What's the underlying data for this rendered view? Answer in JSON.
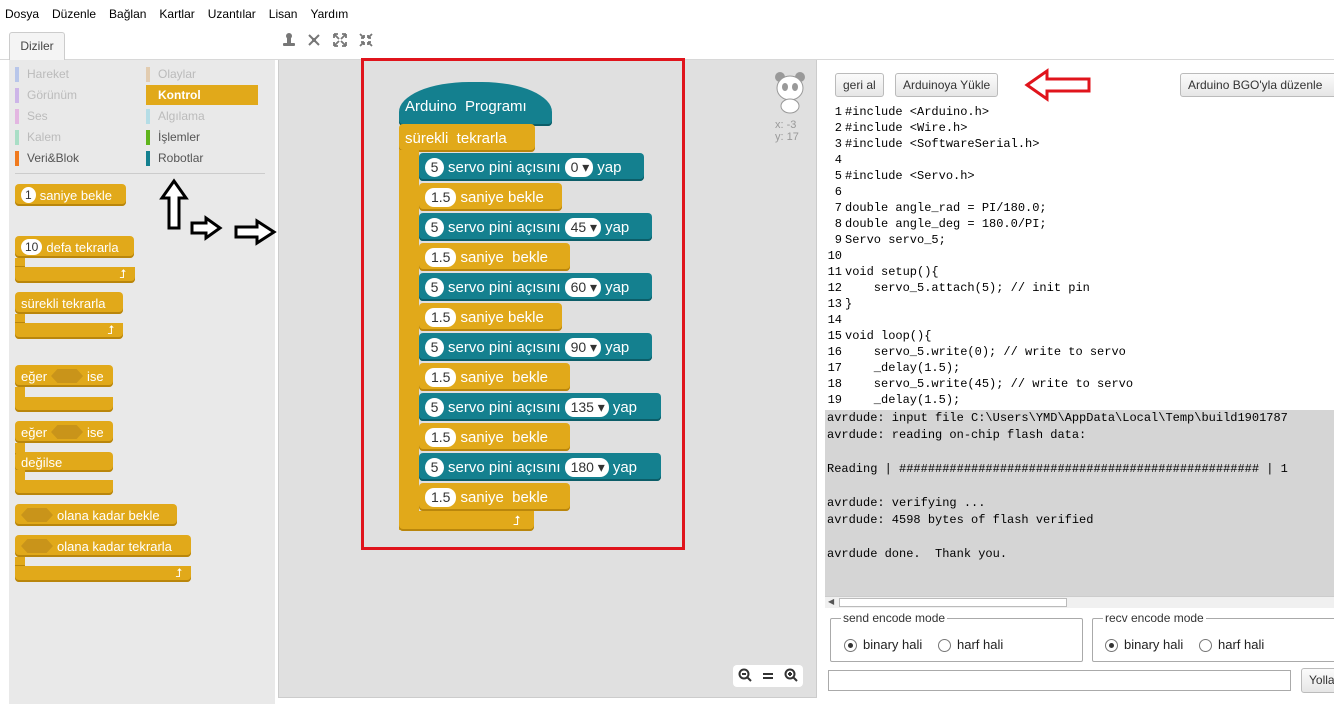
{
  "menu": [
    "Dosya",
    "Düzenle",
    "Bağlan",
    "Kartlar",
    "Uzantılar",
    "Lisan",
    "Yardım"
  ],
  "tab": "Diziler",
  "categories": {
    "left": [
      {
        "label": "Hareket",
        "color": "#b8c6ea"
      },
      {
        "label": "Görünüm",
        "color": "#cdb5e8"
      },
      {
        "label": "Ses",
        "color": "#e3b6e1"
      },
      {
        "label": "Kalem",
        "color": "#a9dec6"
      },
      {
        "label": "Veri&Blok",
        "color": "#f07a1e"
      }
    ],
    "right": [
      {
        "label": "Olaylar",
        "color": "#e2ccb0"
      },
      {
        "label": "Kontrol",
        "color": "#e1a91a"
      },
      {
        "label": "Algılama",
        "color": "#b5dde6"
      },
      {
        "label": "İşlemler",
        "color": "#5fb41c"
      },
      {
        "label": "Robotlar",
        "color": "#14808f"
      }
    ]
  },
  "palette_blocks": {
    "wait": {
      "num": "1",
      "text": "saniye bekle"
    },
    "repeat": {
      "num": "10",
      "text": "defa tekrarla"
    },
    "forever": "sürekli tekrarla",
    "if1": {
      "a": "eğer",
      "b": "ise"
    },
    "if2": {
      "a": "eğer",
      "b": "ise",
      "c": "değilse"
    },
    "waituntil": "olana kadar bekle",
    "repeatuntil": "olana kadar tekrarla"
  },
  "script": {
    "hat": "Arduino  Programı",
    "forever": "sürekli  tekrarla",
    "servo_pin": "5",
    "servo_text": "servo pini açısını",
    "yap": "yap",
    "wait_value": "1.5",
    "wait_text_a": "saniye bekle",
    "wait_text_b": "saniye  bekle",
    "angles": [
      "0",
      "45",
      "60",
      "90",
      "135",
      "180"
    ]
  },
  "coords": {
    "x": "x: -3",
    "y": "y: 17"
  },
  "buttons": {
    "back": "geri al",
    "upload": "Arduinoya Yükle",
    "edit": "Arduino BGO'yla düzenle",
    "send": "Yolla"
  },
  "code_lines": [
    "#include <Arduino.h>",
    "#include <Wire.h>",
    "#include <SoftwareSerial.h>",
    "",
    "#include <Servo.h>",
    "",
    "double angle_rad = PI/180.0;",
    "double angle_deg = 180.0/PI;",
    "Servo servo_5;",
    "",
    "void setup(){",
    "    servo_5.attach(5); // init pin",
    "}",
    "",
    "void loop(){",
    "    servo_5.write(0); // write to servo",
    "    _delay(1.5);",
    "    servo_5.write(45); // write to servo",
    "    _delay(1.5);"
  ],
  "console": [
    "avrdude: input file C:\\Users\\YMD\\AppData\\Local\\Temp\\build1901787",
    "avrdude: reading on-chip flash data:",
    "",
    "Reading | ################################################## | 1",
    "",
    "avrdude: verifying ...",
    "avrdude: 4598 bytes of flash verified",
    "",
    "avrdude done.  Thank you."
  ],
  "send_mode": {
    "legend": "send encode mode",
    "opt1": "binary hali",
    "opt2": "harf hali"
  },
  "recv_mode": {
    "legend": "recv encode mode",
    "opt1": "binary hali",
    "opt2": "harf hali"
  },
  "colors": {
    "control": "#e1a91a",
    "robot": "#14808f",
    "highlight": "#e0141c"
  }
}
